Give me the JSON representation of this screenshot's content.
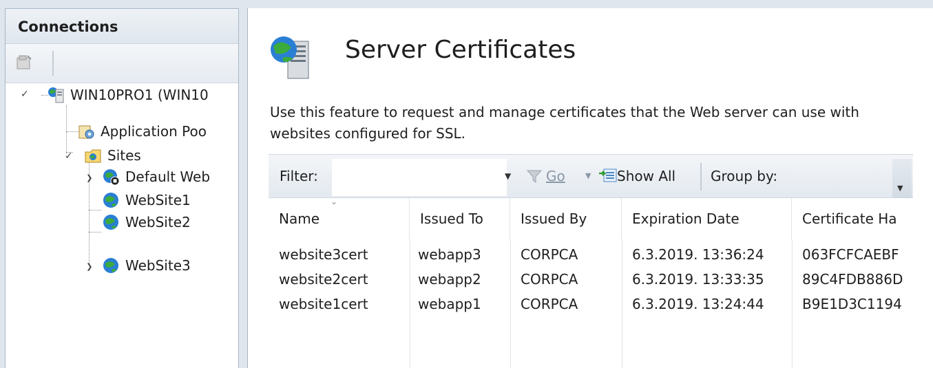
{
  "connections": {
    "title": "Connections",
    "tree": [
      {
        "label": "WIN10PRO1 (WIN10",
        "icon": "server-icon"
      },
      {
        "label": "Application Poo",
        "icon": "app-pool-icon"
      },
      {
        "label": "Sites",
        "icon": "sites-folder-icon"
      },
      {
        "label": "Default Web",
        "icon": "globe-stopped-icon"
      },
      {
        "label": "WebSite1",
        "icon": "globe-icon"
      },
      {
        "label": "WebSite2",
        "icon": "globe-icon"
      },
      {
        "label": "WebSite3",
        "icon": "globe-icon"
      }
    ]
  },
  "feature": {
    "title": "Server Certificates",
    "icon": "server-certificates-icon",
    "description": "Use this feature to request and manage certificates that the Web server can use with websites configured for SSL."
  },
  "filter": {
    "label": "Filter:",
    "value": "",
    "go_label": "Go",
    "show_all_label": "Show All",
    "group_by_label": "Group by:"
  },
  "table": {
    "columns": [
      "Name",
      "Issued To",
      "Issued By",
      "Expiration Date",
      "Certificate Ha"
    ],
    "rows": [
      [
        "website3cert",
        "webapp3",
        "CORPCA",
        "6.3.2019. 13:36:24",
        "063FCFCAEBF"
      ],
      [
        "website2cert",
        "webapp2",
        "CORPCA",
        "6.3.2019. 13:33:35",
        "89C4FDB886D"
      ],
      [
        "website1cert",
        "webapp1",
        "CORPCA",
        "6.3.2019. 13:24:44",
        "B9E1D3C1194"
      ]
    ]
  },
  "colors": {
    "pane_border": "#a9b6c4",
    "background": "#dfe6ee",
    "globe_blue": "#2a7fd4",
    "globe_green": "#3bab3b"
  }
}
